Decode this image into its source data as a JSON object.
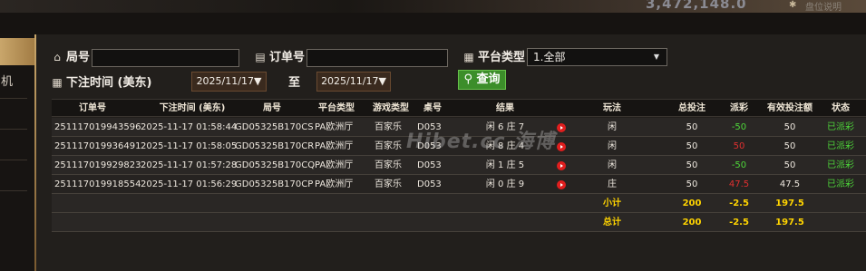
{
  "banner": {
    "amount": "3,472,148.0",
    "right_text": "盘位说明"
  },
  "sidebar": {
    "items": [
      "",
      "机",
      "",
      "",
      ""
    ]
  },
  "filters": {
    "id_label": "局号",
    "id_value": "",
    "order_label": "订单号",
    "order_value": "",
    "platform_label": "平台类型",
    "platform_value": "1.全部",
    "time_label": "下注时间 (美东)",
    "date_from": "2025/11/17▼",
    "to_label": "至",
    "date_to": "2025/11/17▼",
    "query_label": "查询"
  },
  "table": {
    "headers": [
      "订单号",
      "下注时间 (美东)",
      "局号",
      "平台类型",
      "游戏类型",
      "桌号",
      "结果",
      "玩法",
      "总投注",
      "派彩",
      "有效投注额",
      "状态"
    ],
    "rows": [
      {
        "order": "251117019943596",
        "time": "2025-11-17 01:58:44",
        "round": "GD05325B170CS",
        "platform": "PA欧洲厅",
        "game": "百家乐",
        "table": "D053",
        "result": "闲 6 庄 7",
        "play": "闲",
        "bet": "50",
        "payout": "-50",
        "payout_color": "#4ed63a",
        "valid": "50",
        "status": "已派彩"
      },
      {
        "order": "251117019936491",
        "time": "2025-11-17 01:58:05",
        "round": "GD05325B170CR",
        "platform": "PA欧洲厅",
        "game": "百家乐",
        "table": "D053",
        "result": "闲 8 庄 4",
        "play": "闲",
        "bet": "50",
        "payout": "50",
        "payout_color": "#e03030",
        "valid": "50",
        "status": "已派彩"
      },
      {
        "order": "251117019929823",
        "time": "2025-11-17 01:57:28",
        "round": "GD05325B170CQ",
        "platform": "PA欧洲厅",
        "game": "百家乐",
        "table": "D053",
        "result": "闲 1 庄 5",
        "play": "闲",
        "bet": "50",
        "payout": "-50",
        "payout_color": "#4ed63a",
        "valid": "50",
        "status": "已派彩"
      },
      {
        "order": "251117019918554",
        "time": "2025-11-17 01:56:29",
        "round": "GD05325B170CP",
        "platform": "PA欧洲厅",
        "game": "百家乐",
        "table": "D053",
        "result": "闲 0 庄 9",
        "play": "庄",
        "bet": "50",
        "payout": "47.5",
        "payout_color": "#e03030",
        "valid": "47.5",
        "status": "已派彩"
      }
    ],
    "subtotal": {
      "label": "小计",
      "bet": "200",
      "payout": "-2.5",
      "valid": "197.5"
    },
    "total": {
      "label": "总计",
      "bet": "200",
      "payout": "-2.5",
      "valid": "197.5"
    }
  },
  "watermark": "Hibet.cc 海博"
}
